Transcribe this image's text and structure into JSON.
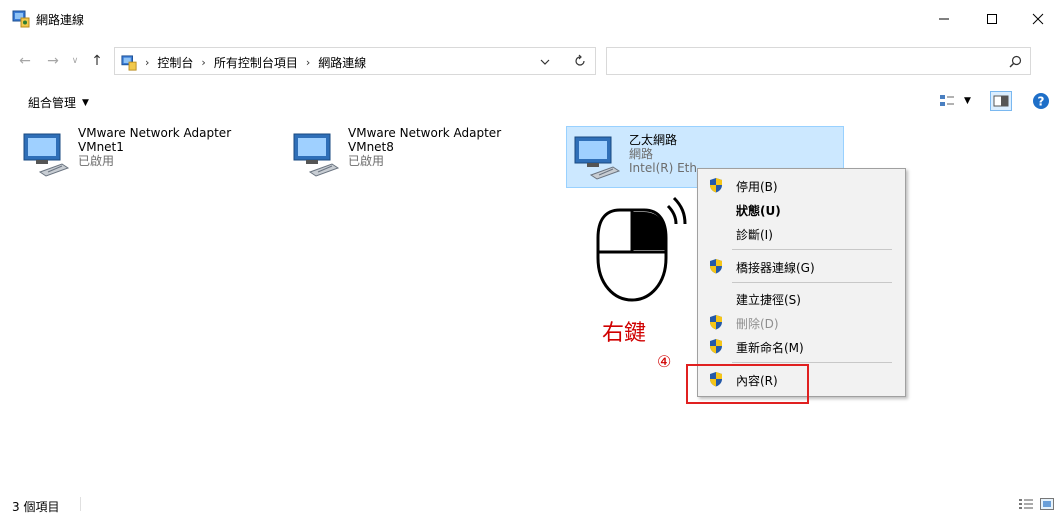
{
  "window": {
    "title": "網路連線",
    "icon": "network-connections-icon",
    "minimize_icon": "minimize-icon",
    "maximize_icon": "maximize-icon",
    "close_icon": "close-icon"
  },
  "navigation": {
    "back_icon": "back-arrow-icon",
    "forward_icon": "forward-arrow-icon",
    "recent_icon": "chevron-down-icon",
    "up_icon": "up-arrow-icon",
    "breadcrumbs": [
      "控制台",
      "所有控制台項目",
      "網路連線"
    ],
    "refresh_icon": "refresh-icon",
    "search_placeholder": "",
    "search_icon": "search-icon"
  },
  "toolbar": {
    "organize_label": "組合管理",
    "view_options_icon": "view-options-icon",
    "preview_pane_icon": "preview-pane-icon",
    "help_icon": "help-icon",
    "help_color": "#1e6fc8"
  },
  "connections": [
    {
      "name": "VMware Network Adapter",
      "line2": "VMnet1",
      "status": "已啟用",
      "selected": false
    },
    {
      "name": "VMware Network Adapter",
      "line2": "VMnet8",
      "status": "已啟用",
      "selected": false
    },
    {
      "name": "乙太網路",
      "line2": "網路",
      "status": "Intel(R) Eth",
      "selected": true
    }
  ],
  "context_menu": {
    "items": [
      {
        "label": "停用(B)",
        "shield": true,
        "style": "normal"
      },
      {
        "label": "狀態(U)",
        "shield": false,
        "style": "bold"
      },
      {
        "label": "診斷(I)",
        "shield": false,
        "style": "normal"
      },
      {
        "label": "橋接器連線(G)",
        "shield": true,
        "style": "normal"
      },
      {
        "label": "建立捷徑(S)",
        "shield": false,
        "style": "normal"
      },
      {
        "label": "刪除(D)",
        "shield": true,
        "style": "disabled"
      },
      {
        "label": "重新命名(M)",
        "shield": true,
        "style": "normal"
      },
      {
        "label": "內容(R)",
        "shield": true,
        "style": "normal"
      }
    ]
  },
  "annotations": {
    "right_click_label": "右鍵",
    "step_label": "④",
    "highlight_color": "#e02020"
  },
  "status_bar": {
    "item_count": "3 個項目",
    "details_view_icon": "details-view-icon",
    "large_icons_view_icon": "large-icons-view-icon"
  },
  "colors": {
    "selection_background": "#cce8ff",
    "selection_border": "#99d1ff",
    "menu_background": "#f2f2f2",
    "annotation_red": "#d00000"
  }
}
